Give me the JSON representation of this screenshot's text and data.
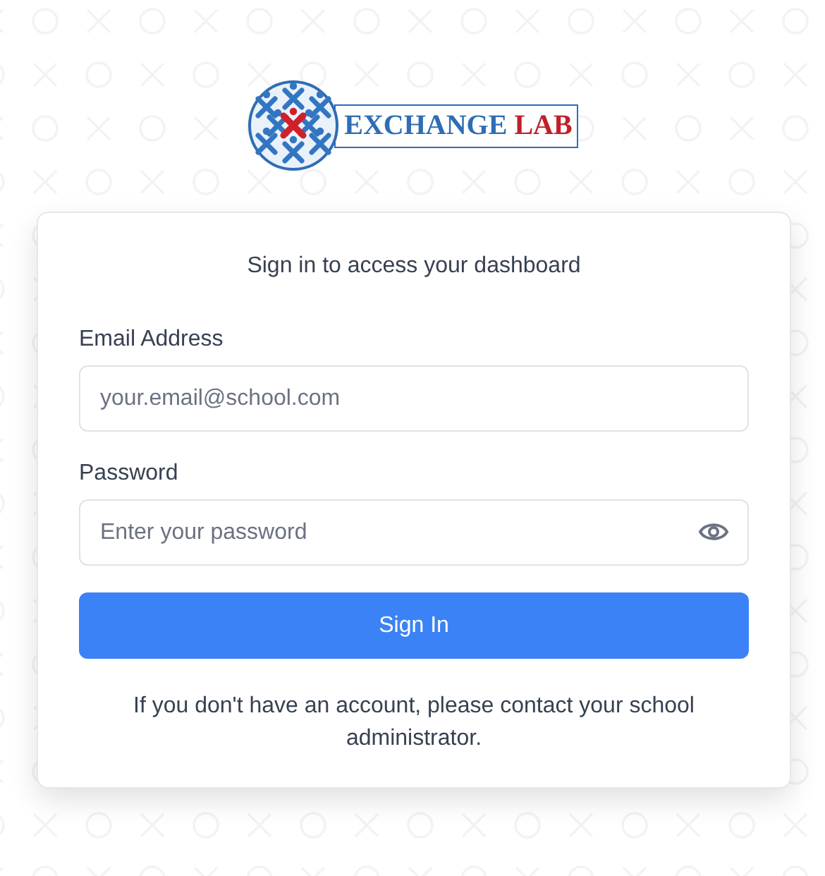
{
  "logo": {
    "word_1": "EXCHANGE",
    "word_2": "LAB"
  },
  "card": {
    "subtitle": "Sign in to access your dashboard",
    "fields": [
      {
        "kind": "email",
        "label": "Email Address",
        "placeholder": "your.email@school.com"
      },
      {
        "kind": "password",
        "label": "Password",
        "placeholder": "Enter your password"
      }
    ],
    "button": "Sign In",
    "note": "If you don't have an account, please contact your school administrator."
  }
}
